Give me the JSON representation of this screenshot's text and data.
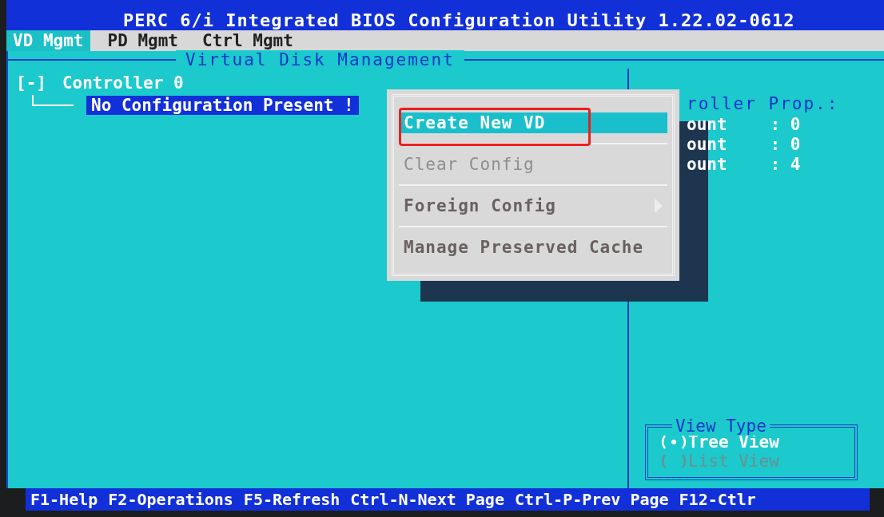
{
  "window": {
    "title": "PERC 6/i Integrated BIOS Configuration Utility 1.22.02-0612"
  },
  "tabs": [
    {
      "label": "VD Mgmt",
      "selected": true
    },
    {
      "label": "PD Mgmt",
      "selected": false
    },
    {
      "label": "Ctrl Mgmt",
      "selected": false
    }
  ],
  "panel": {
    "title": "Virtual Disk Management"
  },
  "tree": [
    {
      "label": "Controller 0",
      "toggle": "[-]",
      "selected": false,
      "children": [
        {
          "label": "No Configuration Present !",
          "selected": true
        }
      ]
    }
  ],
  "properties": {
    "heading": "roller Prop.:",
    "rows": [
      {
        "label": "ount",
        "value": ": 0"
      },
      {
        "label": "ount",
        "value": ": 0"
      },
      {
        "label": "ount",
        "value": ": 4"
      }
    ]
  },
  "menu": {
    "items": [
      {
        "label": "Create New VD",
        "selected": true,
        "disabled": false,
        "submenu": false,
        "annotated": true
      },
      {
        "label": "Clear Config",
        "selected": false,
        "disabled": true,
        "submenu": false,
        "annotated": false
      },
      {
        "label": "Foreign Config",
        "selected": false,
        "disabled": false,
        "submenu": true,
        "annotated": false
      },
      {
        "label": "Manage Preserved Cache",
        "selected": false,
        "disabled": false,
        "submenu": false,
        "annotated": false
      }
    ]
  },
  "view_type": {
    "title": "View Type",
    "options": [
      {
        "label": "Tree View",
        "selected": true,
        "disabled": false
      },
      {
        "label": "List View",
        "selected": false,
        "disabled": true
      }
    ]
  },
  "status_bar": [
    "F1-Help",
    "F2-Operations",
    "F5-Refresh",
    "Ctrl-N-Next Page",
    "Ctrl-P-Prev Page",
    "F12-Ctlr"
  ]
}
